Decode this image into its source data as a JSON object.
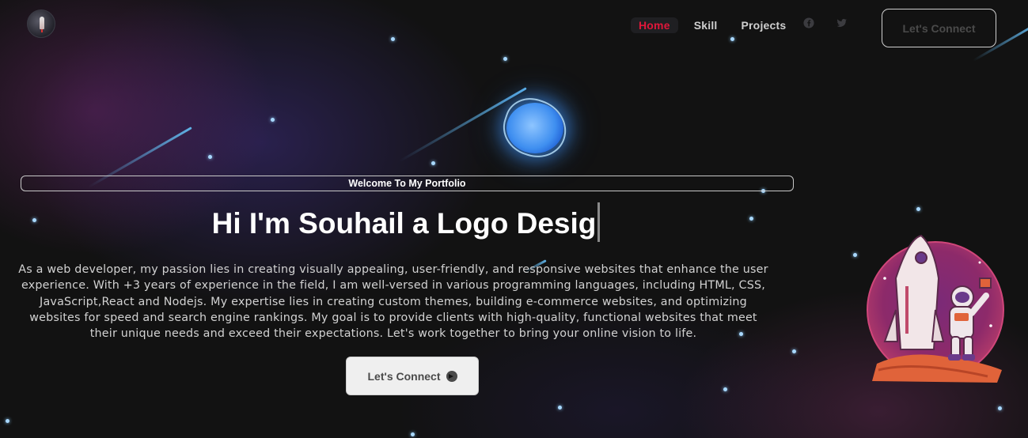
{
  "nav": {
    "items": [
      {
        "label": "Home",
        "active": true
      },
      {
        "label": "Skill",
        "active": false
      },
      {
        "label": "Projects",
        "active": false
      }
    ],
    "social_icons": [
      "facebook-icon",
      "twitter-icon"
    ],
    "connect_label": "Let's Connect"
  },
  "hero": {
    "welcome": "Welcome To My Portfolio",
    "headline": "Hi I'm Souhail a Logo Desig",
    "description": "As a web developer, my passion lies in creating visually appealing, user-friendly, and responsive websites that enhance the user experience. With +3 years of experience in the field, I am well-versed in various programming languages, including HTML, CSS, JavaScript,React and Nodejs. My expertise lies in creating custom themes, building e-commerce websites, and optimizing websites for speed and search engine rankings. My goal is to provide clients with high-quality, functional websites that meet their unique needs and exceed their expectations. Let's work together to bring your online vision to life.",
    "connect_label": "Let's Connect"
  },
  "colors": {
    "accent": "#e0173a",
    "background": "#121212",
    "button_text": "#4a4a4a"
  }
}
